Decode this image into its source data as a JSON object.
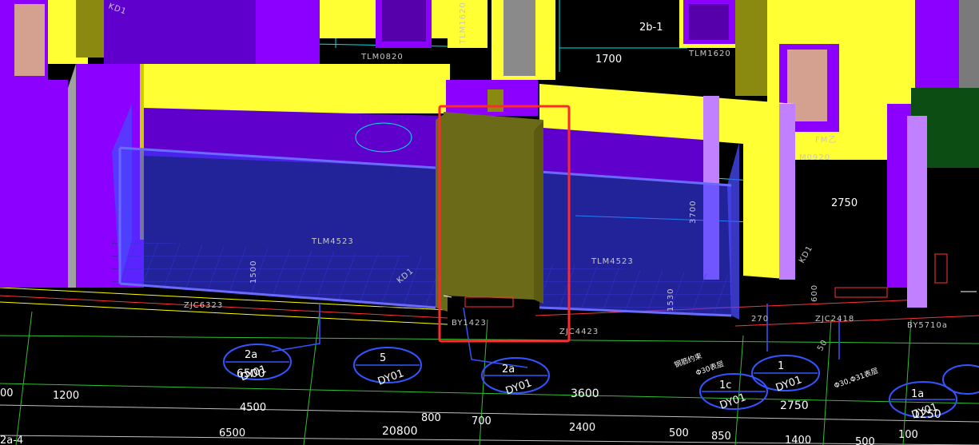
{
  "viewport": {
    "grid_tags": {
      "top_right": "2b-1",
      "bottom_left": "2a-4"
    }
  },
  "labels": {
    "tlm0820": "TLM0820",
    "tlm1620": "TLM1620",
    "tlm1620_vertical": "TLM1620",
    "tlm4523_a": "TLM4523",
    "tlm4523_b": "TLM4523",
    "zjc6323": "ZJC6323",
    "zjc4423": "ZJC4423",
    "zjc2418": "ZJC2418",
    "by1423": "BY1423",
    "by5710a": "BY5710a",
    "kd1_a": "KD1",
    "kd1_b": "KD1",
    "kd1_c": "KD1",
    "fm": "FM乙",
    "m0920": "M0920",
    "v3700": "3700",
    "v1500": "1500",
    "v1530": "1530",
    "v600": "600",
    "v50": "50",
    "v270": "270"
  },
  "dimensions": {
    "d1700": "1700",
    "d2750_top": "2750",
    "d6500_bubble": "6500",
    "d3600": "3600",
    "d2750_bottom": "2750",
    "d1250": "1250",
    "d00": "00",
    "d1200": "1200",
    "d4500": "4500",
    "d800": "800",
    "d700": "700",
    "d2400": "2400",
    "d500": "500",
    "d850": "850",
    "d6500_bottom": "6500",
    "d20800": "20800",
    "d1400": "1400",
    "d500b": "500",
    "d100": "100"
  },
  "bubbles": [
    {
      "top": "2a",
      "bottom": "DY01"
    },
    {
      "top": "5",
      "bottom": "DY01"
    },
    {
      "top": "2a",
      "bottom": "DY01"
    },
    {
      "top": "1c",
      "bottom": "DY01"
    },
    {
      "top": "1",
      "bottom": "DY01"
    },
    {
      "top": "1a",
      "bottom": "DY01"
    }
  ],
  "annotations": {
    "note_a": "钢筋约束",
    "note_b": "Φ30,Φ31表层",
    "note_c": "Φ30表层"
  },
  "selection": {
    "color": "#ff2a2a"
  },
  "colors": {
    "wall_yellow": "#ffff33",
    "wall_purple": "#8c00ff",
    "column_olive": "#6b6a18",
    "glass_blue": "#3b3bff",
    "green_block": "#0b4d12"
  }
}
